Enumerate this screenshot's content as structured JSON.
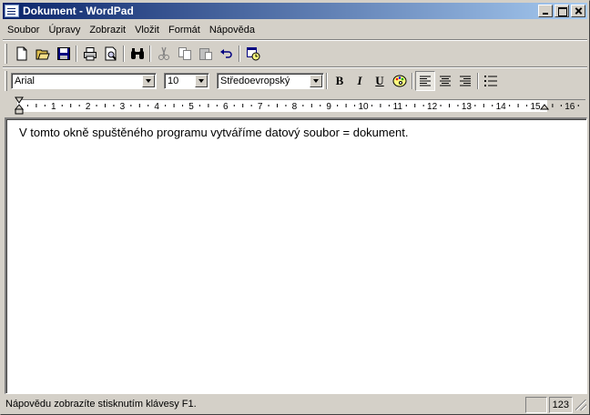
{
  "window": {
    "title": "Dokument - WordPad"
  },
  "menu": [
    "Soubor",
    "Úpravy",
    "Zobrazit",
    "Vložit",
    "Formát",
    "Nápověda"
  ],
  "toolbar": {
    "icons": [
      "new-icon",
      "open-icon",
      "save-icon",
      "print-icon",
      "print-preview-icon",
      "find-icon",
      "cut-icon",
      "copy-icon",
      "paste-icon",
      "undo-icon",
      "date-time-icon"
    ]
  },
  "format": {
    "font": "Arial",
    "size": "10",
    "script": "Středoevropský",
    "bold_label": "B",
    "italic_label": "I",
    "underline_label": "U"
  },
  "ruler": {
    "numbers": [
      "1",
      "2",
      "3",
      "4",
      "5",
      "6",
      "7",
      "8",
      "9",
      "10",
      "11",
      "12",
      "13",
      "14",
      "15",
      "16"
    ]
  },
  "document": {
    "text": "V tomto okně spuštěného programu vytváříme datový soubor = dokument."
  },
  "status": {
    "message": "Nápovědu zobrazíte stisknutím klávesy F1.",
    "num_lock": "123"
  },
  "colors": {
    "titlebar_start": "#0a246a",
    "titlebar_end": "#a6caf0",
    "chrome": "#d4d0c8"
  }
}
